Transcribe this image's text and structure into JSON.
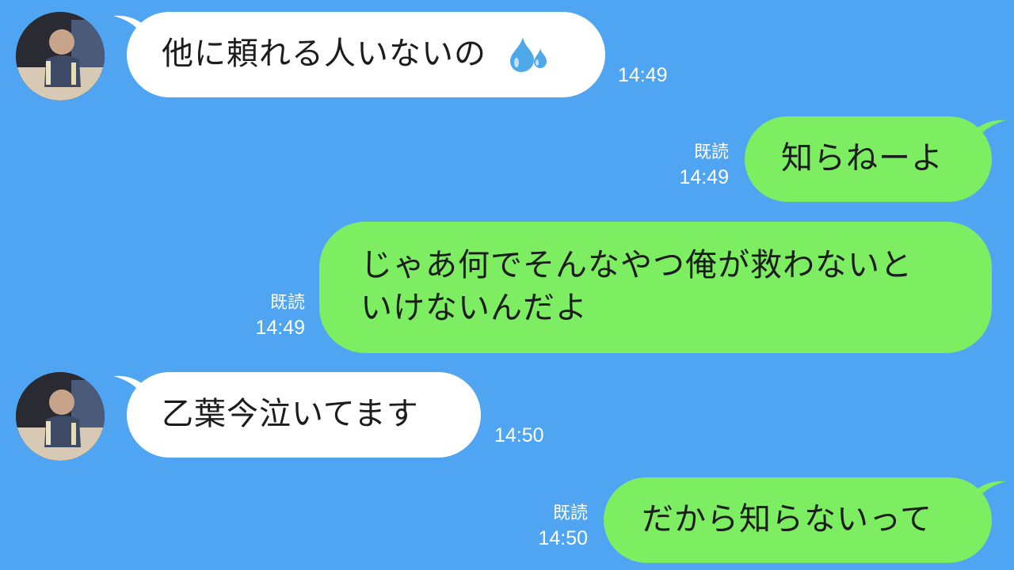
{
  "messages": [
    {
      "side": "in",
      "text": "他に頼れる人いないの",
      "emoji": "sweat-droplets",
      "time": "14:49"
    },
    {
      "side": "out",
      "text": "知らねーよ",
      "read": "既読",
      "time": "14:49"
    },
    {
      "side": "out",
      "lines": [
        "じゃあ何でそんなやつ俺が救わないと",
        "いけないんだよ"
      ],
      "read": "既読",
      "time": "14:49"
    },
    {
      "side": "in",
      "text": "乙葉今泣いてます",
      "time": "14:50"
    },
    {
      "side": "out",
      "text": "だから知らないって",
      "read": "既読",
      "time": "14:50"
    }
  ],
  "colors": {
    "background": "#50a5f3",
    "incoming_bubble": "#ffffff",
    "outgoing_bubble": "#7ded62",
    "meta_text": "#ffffff"
  }
}
